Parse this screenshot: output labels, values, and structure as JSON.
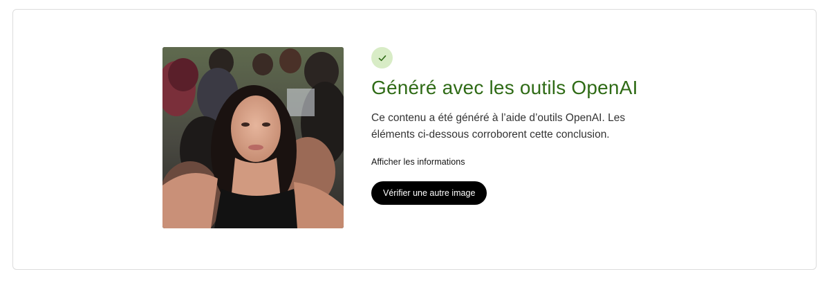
{
  "result": {
    "status_icon": "check-icon",
    "status_color": "#2f6b16",
    "badge_color": "#d8ecc6",
    "title": "Généré avec les outils OpenAI",
    "description": "Ce contenu a été généré à l’aide d’outils OpenAI. Les éléments ci-dessous corroborent cette conclusion.",
    "info_link_label": "Afficher les informations",
    "verify_button_label": "Vérifier une autre image"
  },
  "image": {
    "alt": "selfie"
  }
}
